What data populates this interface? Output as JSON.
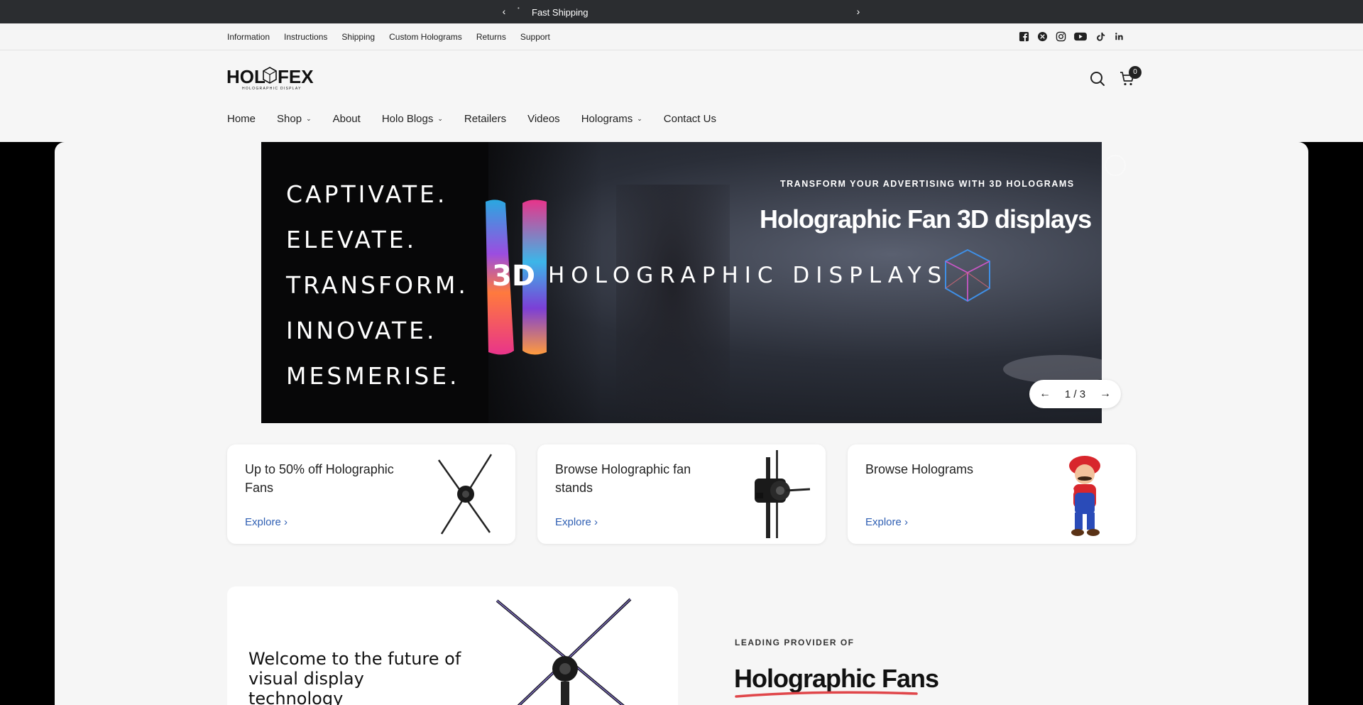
{
  "announcement": {
    "message": "Fast Shipping"
  },
  "utility_nav": [
    "Information",
    "Instructions",
    "Shipping",
    "Custom Holograms",
    "Returns",
    "Support"
  ],
  "social_icons": [
    "facebook-icon",
    "x-icon",
    "instagram-icon",
    "youtube-icon",
    "tiktok-icon",
    "linkedin-icon"
  ],
  "logo": {
    "text": "HOLOFEX",
    "tagline": "HOLOGRAPHIC DISPLAY"
  },
  "cart": {
    "count": "0"
  },
  "main_nav": {
    "home": "Home",
    "shop": "Shop",
    "about": "About",
    "blogs": "Holo Blogs",
    "retailers": "Retailers",
    "videos": "Videos",
    "holograms": "Holograms",
    "contact": "Contact Us"
  },
  "hero": {
    "claims": [
      "CAPTIVATE.",
      "ELEVATE.",
      "TRANSFORM.",
      "INNOVATE.",
      "MESMERISE."
    ],
    "badge_3d": "3D",
    "display_text": "HOLOGRAPHIC  DISPLAYS",
    "eyebrow": "TRANSFORM YOUR ADVERTISING WITH 3D HOLOGRAMS",
    "title": "Holographic Fan 3D displays",
    "slide_indicator": "1 / 3"
  },
  "cards": [
    {
      "title": "Up to 50% off Holographic Fans",
      "link": "Explore"
    },
    {
      "title": "Browse Holographic fan stands",
      "link": "Explore"
    },
    {
      "title": "Browse Holograms",
      "link": "Explore"
    }
  ],
  "welcome": {
    "text": "Welcome to the future of visual display technology"
  },
  "leading": {
    "eyebrow": "LEADING PROVIDER OF",
    "title": "Holographic Fans"
  },
  "colors": {
    "accent_link": "#2f5fb3",
    "announcement_bg": "#2b2d30",
    "underline": "#e0464a"
  }
}
